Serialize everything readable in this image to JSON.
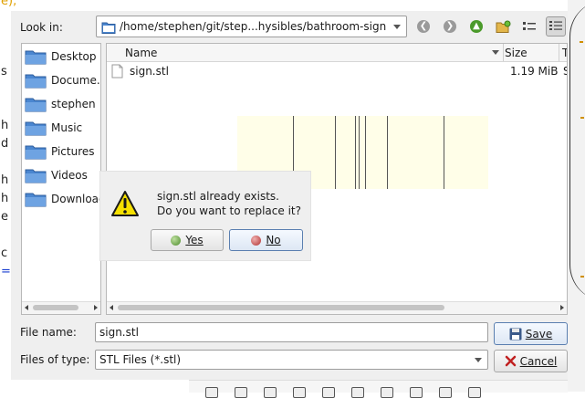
{
  "dialog": {
    "look_in_label": "Look in:",
    "current_path": "/home/stephen/git/step...hysibles/bathroom-sign",
    "nav_icons": [
      "back-arrow-icon",
      "forward-arrow-icon",
      "up-arrow-icon",
      "new-folder-icon",
      "list-view-icon",
      "detail-view-icon"
    ]
  },
  "sidebar": {
    "items": [
      {
        "label": "Desktop",
        "icon": "folder-icon"
      },
      {
        "label": "Docume...",
        "icon": "folder-icon"
      },
      {
        "label": "stephen",
        "icon": "folder-icon"
      },
      {
        "label": "Music",
        "icon": "folder-icon"
      },
      {
        "label": "Pictures",
        "icon": "folder-icon"
      },
      {
        "label": "Videos",
        "icon": "folder-icon"
      },
      {
        "label": "Downloads",
        "icon": "folder-icon"
      }
    ]
  },
  "filelist": {
    "columns": {
      "name": "Name",
      "size": "Size",
      "type": "T"
    },
    "files": [
      {
        "name": "sign.stl",
        "size": "1.19 MiB",
        "type": "S",
        "icon": "document-icon"
      }
    ]
  },
  "confirm": {
    "message_line1": "sign.stl already exists.",
    "message_line2": "Do you want to replace it?",
    "yes_label": "Yes",
    "no_label": "No",
    "icon": "warning-icon"
  },
  "bottom": {
    "file_name_label": "File name:",
    "file_name_value": "sign.stl",
    "files_of_type_label": "Files of type:",
    "files_of_type_value": "STL Files (*.stl)",
    "save_label": "Save",
    "cancel_label": "Cancel"
  },
  "background": {
    "left_chars": [
      "e);",
      "s",
      "h",
      "d",
      "h",
      "h",
      "e",
      "c",
      "="
    ]
  },
  "colors": {
    "folder_blue": "#4a86d0",
    "dialog_bg": "#efefef",
    "preview_bg": "#fffee8",
    "warning_yellow": "#f5e000"
  }
}
